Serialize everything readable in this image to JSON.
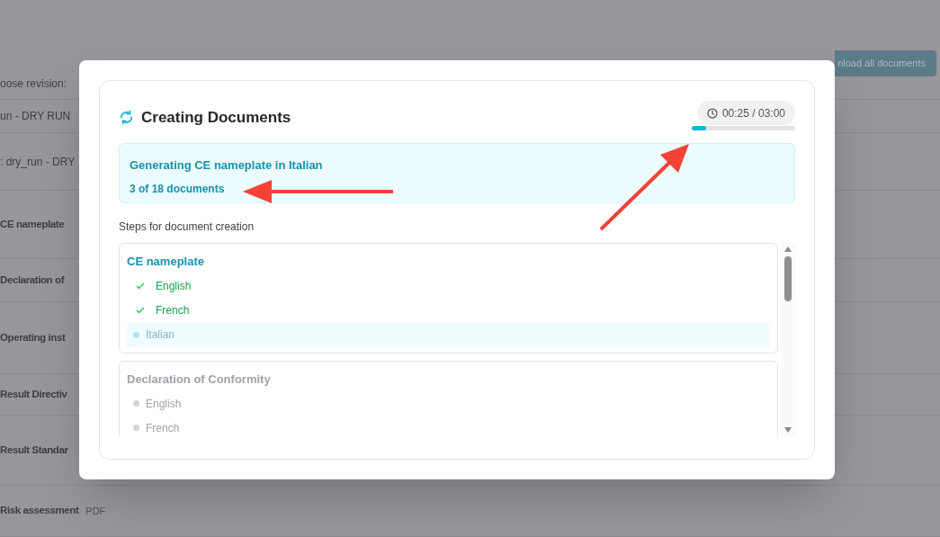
{
  "background": {
    "download_button": "nload all documents",
    "rows": [
      {
        "label": "oose revision:"
      },
      {
        "label": "un - DRY RUN"
      },
      {
        "label": ": dry_run - DRY"
      },
      {
        "label": "CE nameplate"
      },
      {
        "label": "Declaration of"
      },
      {
        "label": "Operating inst"
      },
      {
        "label": "Result Directiv"
      },
      {
        "label": "Result Standar"
      },
      {
        "label": "Risk assessment",
        "tag": "PDF"
      }
    ]
  },
  "dialog": {
    "title": "Creating Documents",
    "timer": "00:25 / 03:00",
    "progress": {
      "level": 0.14
    },
    "status": {
      "message": "Generating CE nameplate in Italian",
      "count": "3 of 18 documents"
    },
    "steps_heading": "Steps for document creation",
    "groups": [
      {
        "title": "CE nameplate",
        "active": true,
        "items": [
          {
            "label": "English",
            "done": true,
            "current": false
          },
          {
            "label": "French",
            "done": true,
            "current": false
          },
          {
            "label": "Italian",
            "done": false,
            "current": true
          }
        ]
      },
      {
        "title": "Declaration of Conformity",
        "active": false,
        "items": [
          {
            "label": "English",
            "done": false,
            "current": false
          },
          {
            "label": "French",
            "done": false,
            "current": false
          }
        ]
      }
    ]
  }
}
